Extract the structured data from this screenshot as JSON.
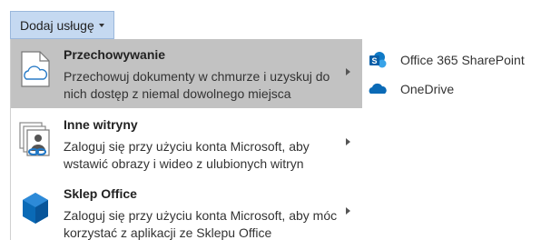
{
  "add_button": {
    "label": "Dodaj usługę"
  },
  "menu": {
    "items": [
      {
        "title": "Przechowywanie",
        "description": "Przechowuj dokumenty w chmurze i uzyskuj do nich dostęp z niemal dowolnego miejsca",
        "icon": "cloud-document-icon",
        "highlighted": true
      },
      {
        "title": "Inne witryny",
        "description": "Zaloguj się przy użyciu konta Microsoft, aby wstawić obrazy i wideo z ulubionych witryn",
        "icon": "linked-sites-icon",
        "highlighted": false
      },
      {
        "title": "Sklep Office",
        "description": "Zaloguj się przy użyciu konta Microsoft, aby móc korzystać z aplikacji ze Sklepu Office",
        "icon": "office-store-icon",
        "highlighted": false
      }
    ]
  },
  "submenu": {
    "items": [
      {
        "label": "Office 365 SharePoint",
        "icon": "sharepoint-icon"
      },
      {
        "label": "OneDrive",
        "icon": "onedrive-icon"
      }
    ]
  },
  "colors": {
    "button_bg": "#c5d9f1",
    "highlight_bg": "#c2c2c2",
    "accent_blue": "#0a6ab6"
  }
}
